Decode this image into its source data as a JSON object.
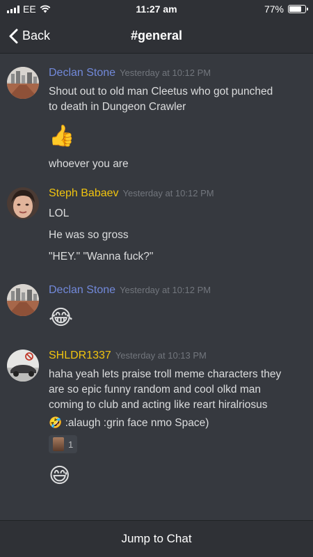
{
  "status_bar": {
    "carrier": "EE",
    "time": "11:27 am",
    "battery": "77%",
    "battery_level": 0.77
  },
  "nav": {
    "back_label": "Back",
    "title": "#general"
  },
  "messages": [
    {
      "author": "Declan Stone",
      "author_color": "#7289da",
      "timestamp": "Yesterday at 10:12 PM",
      "lines": [
        "Shout out to old man Cleetus who got punched",
        "to death in Dungeon Crawler",
        "👍",
        "whoever you are"
      ]
    },
    {
      "author": "Steph Babaev",
      "author_color": "#f1c40f",
      "timestamp": "Yesterday at 10:12 PM",
      "lines": [
        "LOL",
        "He was so gross",
        "\"HEY.\" \"Wanna fuck?\""
      ]
    },
    {
      "author": "Declan Stone",
      "author_color": "#7289da",
      "timestamp": "Yesterday at 10:12 PM",
      "lines": [
        "😂"
      ]
    },
    {
      "author": "SHLDR1337",
      "author_color": "#f1c40f",
      "timestamp": "Yesterday at 10:13 PM",
      "lines": [
        "haha yeah lets praise troll meme characters they",
        "are so epic funny random and cool olkd man",
        "coming to club and acting like reart hiralriosus",
        "🤣 :alaugh :grin face nmo Space)"
      ],
      "reaction_count": "1",
      "extra_emoji": "😅"
    }
  ],
  "footer": {
    "jump_label": "Jump to Chat"
  }
}
